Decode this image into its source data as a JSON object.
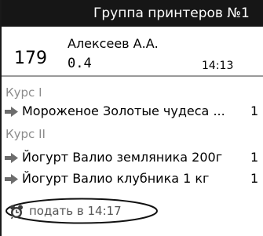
{
  "colors": {
    "title_bar_bg": "#161616",
    "title_bar_text": "#ffffff",
    "course_label": "#8c8c8c",
    "arrow_icon": "#6d6d6d",
    "serve_text": "#555555"
  },
  "card": {
    "title": "Группа принтеров №1",
    "order": {
      "number": "179",
      "waiter": "Алексеев А.А.",
      "code": "0.4",
      "time": "14:13"
    },
    "courses": [
      {
        "label": "Курс I",
        "items": [
          {
            "icon": "arrow-right-icon",
            "name": "Мороженое Золотые чудеса ...",
            "qty": "1"
          }
        ]
      },
      {
        "label": "Курс II",
        "items": [
          {
            "icon": "arrow-right-icon",
            "name": "Йогурт Валио земляника 200г",
            "qty": "1"
          },
          {
            "icon": "arrow-right-icon",
            "name": "Йогурт Валио клубника 1 кг",
            "qty": "1"
          }
        ]
      }
    ],
    "serve": {
      "icon": "alarm-clock-icon",
      "text": "подать в 14:17"
    }
  }
}
